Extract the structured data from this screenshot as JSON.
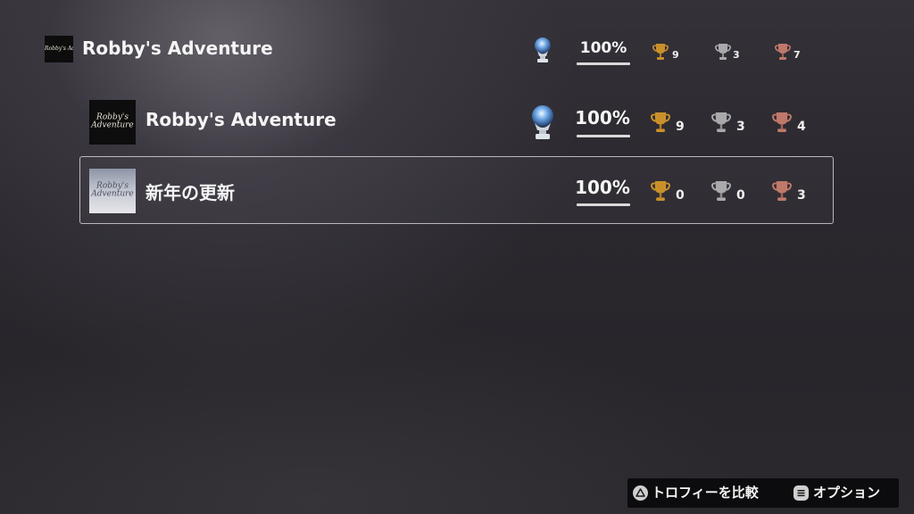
{
  "game": {
    "title": "Robby's Adventure",
    "thumb_text": "Robby's Adventure",
    "progress": "100%",
    "progress_fraction": 1.0,
    "platinum": true,
    "gold": "9",
    "silver": "3",
    "bronze": "7"
  },
  "groups": [
    {
      "title": "Robby's Adventure",
      "thumb_text": "Robby's Adventure",
      "progress": "100%",
      "progress_fraction": 1.0,
      "platinum": true,
      "gold": "9",
      "silver": "3",
      "bronze": "4",
      "selected": false
    },
    {
      "title": "新年の更新",
      "thumb_text": "Robby's Adventure",
      "progress": "100%",
      "progress_fraction": 1.0,
      "platinum": false,
      "gold": "0",
      "silver": "0",
      "bronze": "3",
      "selected": true
    }
  ],
  "footer": {
    "compare_label": "トロフィーを比較",
    "compare_button": "triangle-button-icon",
    "options_label": "オプション",
    "options_button": "options-button-icon"
  },
  "colors": {
    "gold": "#c9902a",
    "silver": "#a9a9ab",
    "bronze": "#c0786a",
    "platinum": "#6ea8e8"
  },
  "icons": [
    "platinum-trophy-icon",
    "gold-trophy-icon",
    "silver-trophy-icon",
    "bronze-trophy-icon"
  ]
}
